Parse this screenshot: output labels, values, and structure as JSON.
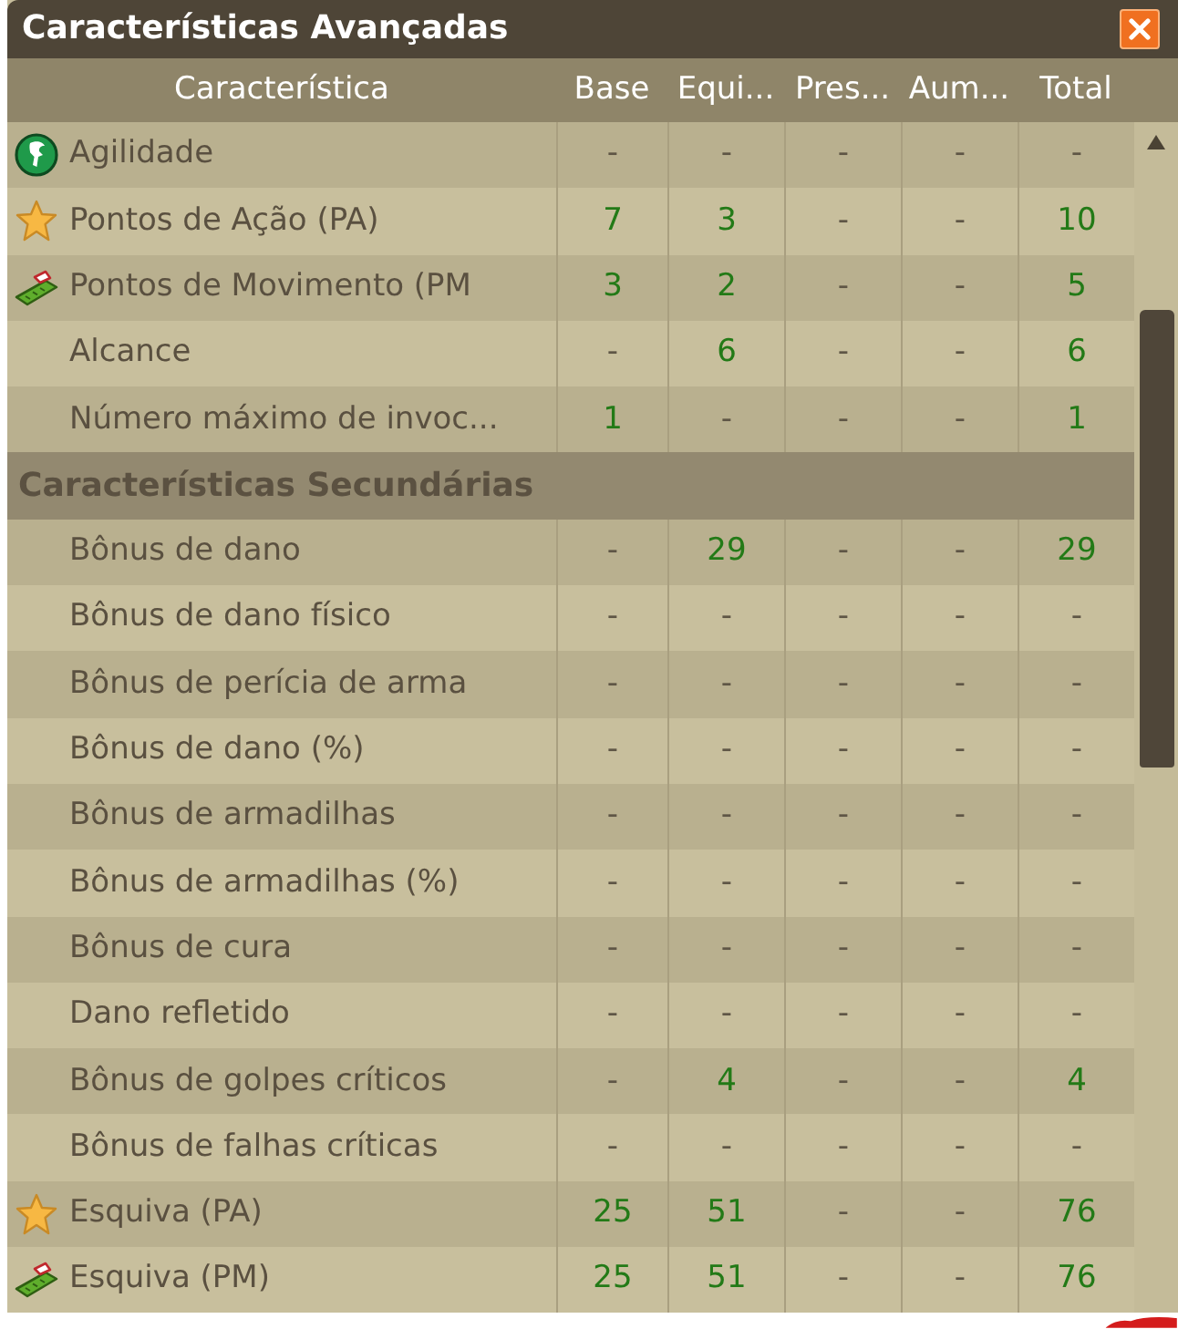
{
  "window": {
    "title": "Características Avançadas"
  },
  "table": {
    "columns": [
      "Característica",
      "Base",
      "Equi...",
      "Pres...",
      "Aum...",
      "Total"
    ],
    "rows": [
      {
        "kind": "agility",
        "label": "Agilidade",
        "cells": [
          {
            "text": "-",
            "color": "#5f5646"
          },
          {
            "text": "-",
            "color": "#5f5646"
          },
          {
            "text": "-",
            "color": "#5f5646"
          },
          {
            "text": "-",
            "color": "#5f5646"
          },
          {
            "text": "-",
            "color": "#5f5646"
          }
        ]
      },
      {
        "kind": "action",
        "label": "Pontos de Ação (PA)",
        "cells": [
          {
            "text": "7",
            "color": "#237a17"
          },
          {
            "text": "3",
            "color": "#237a17"
          },
          {
            "text": "-",
            "color": "#5f5646"
          },
          {
            "text": "-",
            "color": "#5f5646"
          },
          {
            "text": "10",
            "color": "#237a17"
          }
        ]
      },
      {
        "kind": "movement",
        "label": "Pontos de Movimento (PM",
        "cells": [
          {
            "text": "3",
            "color": "#237a17"
          },
          {
            "text": "2",
            "color": "#237a17"
          },
          {
            "text": "-",
            "color": "#5f5646"
          },
          {
            "text": "-",
            "color": "#5f5646"
          },
          {
            "text": "5",
            "color": "#237a17"
          }
        ]
      },
      {
        "kind": "plain",
        "label": "Alcance",
        "cells": [
          {
            "text": "-",
            "color": "#5f5646"
          },
          {
            "text": "6",
            "color": "#237a17"
          },
          {
            "text": "-",
            "color": "#5f5646"
          },
          {
            "text": "-",
            "color": "#5f5646"
          },
          {
            "text": "6",
            "color": "#237a17"
          }
        ]
      },
      {
        "kind": "plain",
        "label": "Número máximo de invoc...",
        "cells": [
          {
            "text": "1",
            "color": "#237a17"
          },
          {
            "text": "-",
            "color": "#5f5646"
          },
          {
            "text": "-",
            "color": "#5f5646"
          },
          {
            "text": "-",
            "color": "#5f5646"
          },
          {
            "text": "1",
            "color": "#237a17"
          }
        ]
      },
      {
        "kind": "section",
        "label": "Características Secundárias"
      },
      {
        "kind": "plain",
        "label": "Bônus de dano",
        "cells": [
          {
            "text": "-",
            "color": "#5f5646"
          },
          {
            "text": "29",
            "color": "#237a17"
          },
          {
            "text": "-",
            "color": "#5f5646"
          },
          {
            "text": "-",
            "color": "#5f5646"
          },
          {
            "text": "29",
            "color": "#237a17"
          }
        ]
      },
      {
        "kind": "plain",
        "label": "Bônus de dano físico",
        "cells": [
          {
            "text": "-",
            "color": "#5f5646"
          },
          {
            "text": "-",
            "color": "#5f5646"
          },
          {
            "text": "-",
            "color": "#5f5646"
          },
          {
            "text": "-",
            "color": "#5f5646"
          },
          {
            "text": "-",
            "color": "#5f5646"
          }
        ]
      },
      {
        "kind": "plain",
        "label": "Bônus de perícia de arma",
        "cells": [
          {
            "text": "-",
            "color": "#5f5646"
          },
          {
            "text": "-",
            "color": "#5f5646"
          },
          {
            "text": "-",
            "color": "#5f5646"
          },
          {
            "text": "-",
            "color": "#5f5646"
          },
          {
            "text": "-",
            "color": "#5f5646"
          }
        ]
      },
      {
        "kind": "plain",
        "label": "Bônus de dano (%)",
        "cells": [
          {
            "text": "-",
            "color": "#5f5646"
          },
          {
            "text": "-",
            "color": "#5f5646"
          },
          {
            "text": "-",
            "color": "#5f5646"
          },
          {
            "text": "-",
            "color": "#5f5646"
          },
          {
            "text": "-",
            "color": "#5f5646"
          }
        ]
      },
      {
        "kind": "plain",
        "label": "Bônus de armadilhas",
        "cells": [
          {
            "text": "-",
            "color": "#5f5646"
          },
          {
            "text": "-",
            "color": "#5f5646"
          },
          {
            "text": "-",
            "color": "#5f5646"
          },
          {
            "text": "-",
            "color": "#5f5646"
          },
          {
            "text": "-",
            "color": "#5f5646"
          }
        ]
      },
      {
        "kind": "plain",
        "label": "Bônus de armadilhas (%)",
        "cells": [
          {
            "text": "-",
            "color": "#5f5646"
          },
          {
            "text": "-",
            "color": "#5f5646"
          },
          {
            "text": "-",
            "color": "#5f5646"
          },
          {
            "text": "-",
            "color": "#5f5646"
          },
          {
            "text": "-",
            "color": "#5f5646"
          }
        ]
      },
      {
        "kind": "plain",
        "label": "Bônus de cura",
        "cells": [
          {
            "text": "-",
            "color": "#5f5646"
          },
          {
            "text": "-",
            "color": "#5f5646"
          },
          {
            "text": "-",
            "color": "#5f5646"
          },
          {
            "text": "-",
            "color": "#5f5646"
          },
          {
            "text": "-",
            "color": "#5f5646"
          }
        ]
      },
      {
        "kind": "plain",
        "label": "Dano refletido",
        "cells": [
          {
            "text": "-",
            "color": "#5f5646"
          },
          {
            "text": "-",
            "color": "#5f5646"
          },
          {
            "text": "-",
            "color": "#5f5646"
          },
          {
            "text": "-",
            "color": "#5f5646"
          },
          {
            "text": "-",
            "color": "#5f5646"
          }
        ]
      },
      {
        "kind": "plain",
        "label": "Bônus de golpes críticos",
        "cells": [
          {
            "text": "-",
            "color": "#5f5646"
          },
          {
            "text": "4",
            "color": "#237a17"
          },
          {
            "text": "-",
            "color": "#5f5646"
          },
          {
            "text": "-",
            "color": "#5f5646"
          },
          {
            "text": "4",
            "color": "#237a17"
          }
        ]
      },
      {
        "kind": "plain",
        "label": "Bônus de falhas críticas",
        "cells": [
          {
            "text": "-",
            "color": "#5f5646"
          },
          {
            "text": "-",
            "color": "#5f5646"
          },
          {
            "text": "-",
            "color": "#5f5646"
          },
          {
            "text": "-",
            "color": "#5f5646"
          },
          {
            "text": "-",
            "color": "#5f5646"
          }
        ]
      },
      {
        "kind": "action",
        "label": "Esquiva (PA)",
        "cells": [
          {
            "text": "25",
            "color": "#237a17"
          },
          {
            "text": "51",
            "color": "#237a17"
          },
          {
            "text": "-",
            "color": "#5f5646"
          },
          {
            "text": "-",
            "color": "#5f5646"
          },
          {
            "text": "76",
            "color": "#237a17"
          }
        ]
      },
      {
        "kind": "movement",
        "label": "Esquiva (PM)",
        "cells": [
          {
            "text": "25",
            "color": "#237a17"
          },
          {
            "text": "51",
            "color": "#237a17"
          },
          {
            "text": "-",
            "color": "#5f5646"
          },
          {
            "text": "-",
            "color": "#5f5646"
          },
          {
            "text": "76",
            "color": "#237a17"
          }
        ]
      }
    ]
  }
}
